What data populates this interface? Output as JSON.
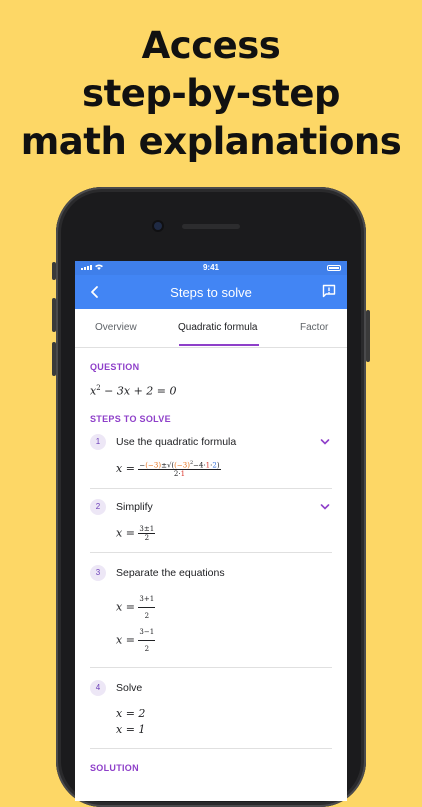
{
  "headline": {
    "line1": "Access",
    "line2": "step-by-step",
    "line3": "math explanations"
  },
  "status_bar": {
    "time": "9:41"
  },
  "app_bar": {
    "title": "Steps to solve",
    "back_icon": "chevron-left-icon",
    "report_icon": "report-feedback-icon"
  },
  "tabs": [
    {
      "label": "Overview",
      "active": false
    },
    {
      "label": "Quadratic formula",
      "active": true
    },
    {
      "label": "Factor",
      "active": false
    }
  ],
  "question": {
    "label": "QUESTION",
    "equation": {
      "x": "x",
      "exp": "2",
      "rest": " − 3x + 2 = 0"
    }
  },
  "steps_label": "STEPS TO SOLVE",
  "steps": [
    {
      "number": "1",
      "title": "Use the quadratic formula",
      "expanded_icon": "chevron-down-icon",
      "formula": {
        "lhs": "x =",
        "num_minus": "−",
        "num_b": "(−3)",
        "num_pm": "±",
        "num_root_open": "√(",
        "num_b2": "(−3)",
        "num_sq": "2",
        "num_minus4": "−4·",
        "num_a": "1",
        "num_dot": "·",
        "num_c": "2",
        "num_root_close": ")",
        "den_2": "2·",
        "den_a": "1"
      }
    },
    {
      "number": "2",
      "title": "Simplify",
      "expanded_icon": "chevron-down-icon",
      "formula": {
        "lhs": "x =",
        "num": "3±1",
        "den": "2"
      }
    },
    {
      "number": "3",
      "title": "Separate the equations",
      "formulas": [
        {
          "lhs": "x =",
          "num": "3+1",
          "den": "2"
        },
        {
          "lhs": "x =",
          "num": "3−1",
          "den": "2"
        }
      ]
    },
    {
      "number": "4",
      "title": "Solve",
      "results": [
        "x = 2",
        "x = 1"
      ]
    }
  ],
  "solution_label": "SOLUTION",
  "colors": {
    "background": "#FDD766",
    "app_bar": "#4285F4",
    "accent_purple": "#8E3FC9",
    "coef_orange": "#E8711A",
    "coef_blue": "#2F6BD8",
    "coef_red": "#D93025"
  }
}
